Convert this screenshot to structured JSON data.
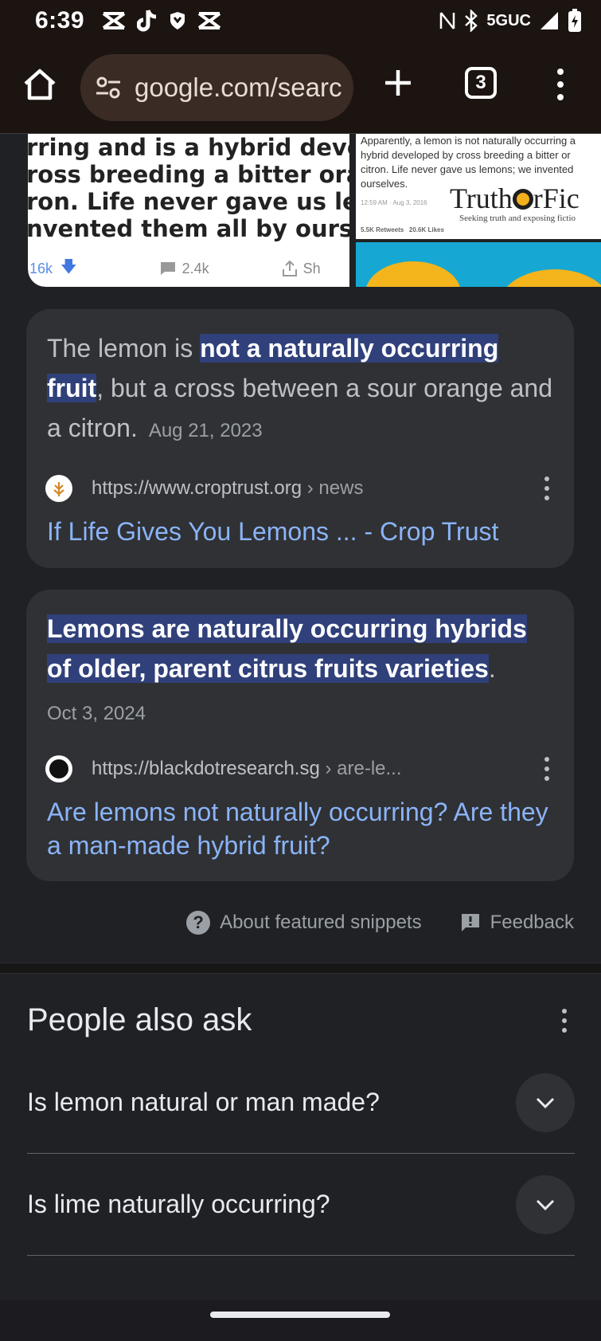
{
  "status_bar": {
    "time": "6:39",
    "network": "5GUC",
    "notification_icons": [
      "capcut-icon",
      "tiktok-icon",
      "shield-app-icon",
      "capcut-icon"
    ]
  },
  "browser": {
    "url": "google.com/searc",
    "tab_count": "3"
  },
  "images": {
    "image1": {
      "lines": [
        "rring and is a hybrid develope",
        "ross breeding a bitter orange",
        "ron. Life never gave us lemon",
        "nvented them all by ourselves"
      ],
      "likes": "16k",
      "comments": "2.4k",
      "share": "Sh"
    },
    "image2": {
      "lines": [
        "Apparently, a lemon is not naturally occurring a",
        "hybrid developed by cross breeding a bitter or",
        "citron. Life never gave us lemons; we invented",
        "ourselves."
      ],
      "meta": "12:59 AM · Aug 3, 2016",
      "retweets": "5.5K Retweets",
      "likes": "20.6K Likes",
      "logo_left": "Truth",
      "logo_right": "rFic",
      "tagline": "Seeking truth and exposing fictio"
    }
  },
  "snippets": [
    {
      "text_before": "The lemon is ",
      "text_highlight_1": "not a naturally occurring",
      "text_highlight_2": "fruit",
      "text_after": ", but a cross between a sour orange and a citron.",
      "date": "Aug 21, 2023",
      "source_domain": "https://www.croptrust.org",
      "source_path": " › news",
      "title": "If Life Gives You Lemons ... - Crop Trust"
    },
    {
      "text_highlight_1": "Lemons are naturally occurring hybrids",
      "text_highlight_2": "of older, parent citrus fruits varieties",
      "text_after": ".",
      "date": "Oct 3, 2024",
      "source_domain": "https://blackdotresearch.sg",
      "source_path": " › are-le...",
      "title": "Are lemons not naturally occurring? Are they a man-made hybrid fruit?"
    }
  ],
  "footer": {
    "about": "About featured snippets",
    "feedback": "Feedback"
  },
  "paa": {
    "title": "People also ask",
    "questions": [
      "Is lemon natural or man made?",
      "Is lime naturally occurring?"
    ]
  },
  "colors": {
    "background": "#202124",
    "card": "#303134",
    "link": "#8ab4f8",
    "highlight": "#30407a",
    "toolbar": "#1c1411"
  }
}
